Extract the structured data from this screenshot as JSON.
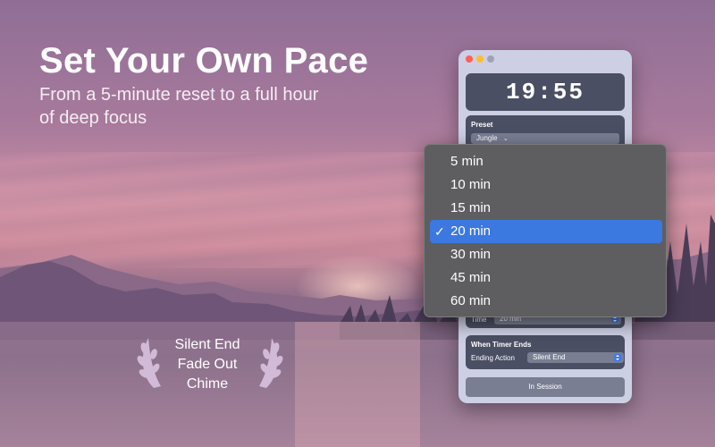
{
  "headline": "Set Your Own Pace",
  "subline": "From a 5-minute reset to a full hour of deep focus",
  "ending_options": [
    "Silent End",
    "Fade Out",
    "Chime"
  ],
  "window": {
    "timer": "19:55",
    "preset_title": "Preset",
    "preset_value": "Jungle",
    "time_label": "Time",
    "time_value": "20 min",
    "timer_ends_title": "When Timer Ends",
    "ending_action_label": "Ending Action",
    "ending_action_value": "Silent End",
    "session_button": "In Session",
    "traffic_lights": [
      "#fe5f57",
      "#febc2e",
      "#9ea2b8"
    ]
  },
  "dropdown": {
    "options": [
      "5 min",
      "10 min",
      "15 min",
      "20 min",
      "30 min",
      "45 min",
      "60 min"
    ],
    "selected_index": 3,
    "check_glyph": "✓"
  },
  "colors": {
    "accent": "#3b78e0",
    "menu_bg": "#5e5e60",
    "window_bg": "#cdd0e4"
  }
}
